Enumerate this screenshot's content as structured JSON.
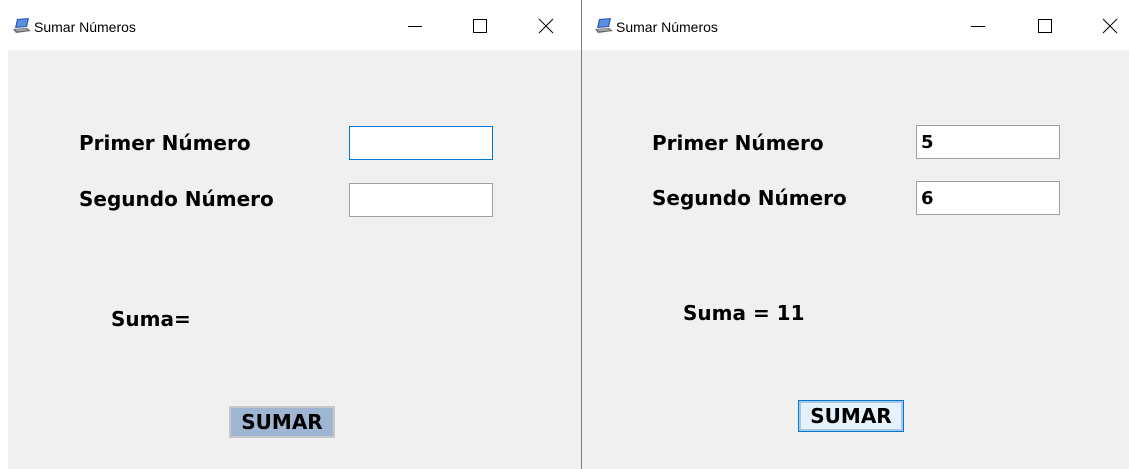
{
  "left_window": {
    "title": "Sumar Números",
    "primer_label": "Primer Número",
    "segundo_label": "Segundo Número",
    "primer_value": "",
    "segundo_value": "",
    "result_text": "Suma=",
    "button_label": "SUMAR"
  },
  "right_window": {
    "title": "Sumar Números",
    "primer_label": "Primer Número",
    "segundo_label": "Segundo Número",
    "primer_value": "5",
    "segundo_value": "6",
    "result_text": "Suma = 11",
    "button_label": "SUMAR"
  },
  "icons": {
    "app": "laptop-icon",
    "minimize": "minimize-icon",
    "maximize": "maximize-icon",
    "close": "close-icon"
  },
  "colors": {
    "client_bg": "#f0f0f0",
    "focus_border": "#0078d7",
    "left_button_bg": "#9fb6d3",
    "right_button_bg": "#e5f1fb"
  }
}
